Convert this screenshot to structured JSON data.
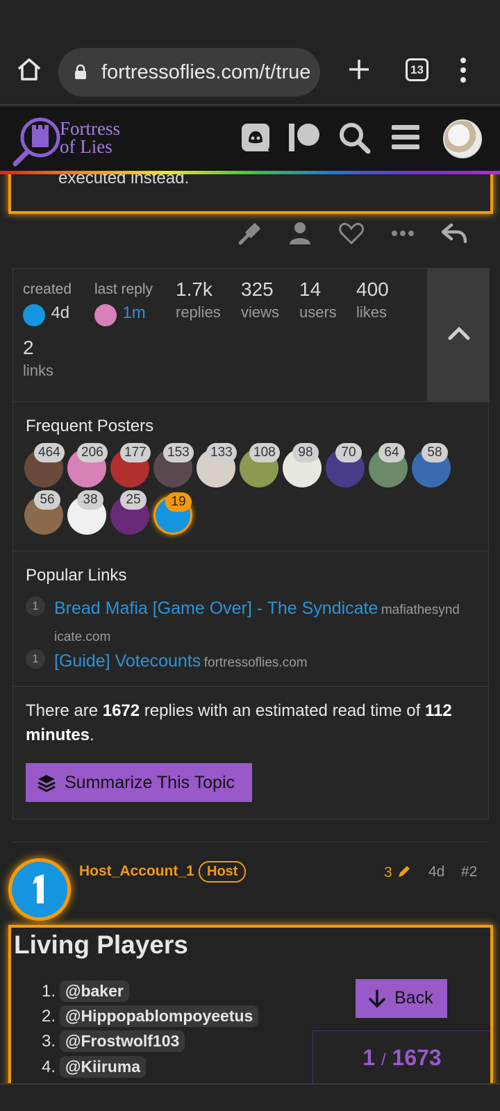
{
  "browser": {
    "url": "fortressoflies.com/t/true",
    "tab_count": "13"
  },
  "site": {
    "logo_line1": "Fortress",
    "logo_line2": "of Lies",
    "icons": [
      "discord-icon",
      "patreon-icon",
      "search-icon",
      "hamburger-menu-icon",
      "user-avatar"
    ]
  },
  "previous_post": {
    "tail_text": "executed instead."
  },
  "topic_map": {
    "created_label": "created",
    "created_value": "4d",
    "last_reply_label": "last reply",
    "last_reply_value": "1m",
    "replies_value": "1.7k",
    "replies_label": "replies",
    "views_value": "325",
    "views_label": "views",
    "users_value": "14",
    "users_label": "users",
    "likes_value": "400",
    "likes_label": "likes",
    "links_value": "2",
    "links_label": "links",
    "frequent_posters_title": "Frequent Posters",
    "posters": [
      {
        "count": "464",
        "color": "#6a4a3a"
      },
      {
        "count": "206",
        "color": "#d880b8"
      },
      {
        "count": "177",
        "color": "#b03030"
      },
      {
        "count": "153",
        "color": "#5a4a50"
      },
      {
        "count": "133",
        "color": "#d8d0c8"
      },
      {
        "count": "108",
        "color": "#8a9a50"
      },
      {
        "count": "98",
        "color": "#e8e8e0"
      },
      {
        "count": "70",
        "color": "#4a3a8a"
      },
      {
        "count": "64",
        "color": "#6a8a6a"
      },
      {
        "count": "58",
        "color": "#3a6ab0"
      },
      {
        "count": "56",
        "color": "#8a6a4a"
      },
      {
        "count": "38",
        "color": "#f0f0f0"
      },
      {
        "count": "25",
        "color": "#6a2a7a"
      },
      {
        "count": "19",
        "color": "#1595df"
      }
    ],
    "popular_links_title": "Popular Links",
    "links": [
      {
        "clicks": "1",
        "title": "Bread Mafia [Game Over] - The Syndicate",
        "domain_a": "mafiathesynd",
        "domain_b": "icate.com"
      },
      {
        "clicks": "1",
        "title": "[Guide] Votecounts",
        "domain_a": "fortressoflies.com",
        "domain_b": ""
      }
    ],
    "summary_pre": "There are ",
    "summary_replies": "1672",
    "summary_mid": " replies with an estimated read time of ",
    "summary_minutes": "112 minutes",
    "summary_post": ".",
    "summarize_button": "Summarize This Topic"
  },
  "host_post": {
    "username": "Host_Account_1",
    "badge": "Host",
    "edit_count": "3",
    "age": "4d",
    "post_number": "#2",
    "heading": "Living Players",
    "players": [
      {
        "num": "1.",
        "name": "@baker"
      },
      {
        "num": "2.",
        "name": "@Hippopablompoyeetus"
      },
      {
        "num": "3.",
        "name": "@Frostwolf103"
      },
      {
        "num": "4.",
        "name": "@Kiiruma"
      }
    ],
    "back_button": "Back",
    "progress_current": "1",
    "progress_sep": "/",
    "progress_total": "1673"
  },
  "colors": {
    "accent_orange": "#f29a0d",
    "accent_purple": "#9859c9",
    "link_blue": "#2d93d6"
  }
}
